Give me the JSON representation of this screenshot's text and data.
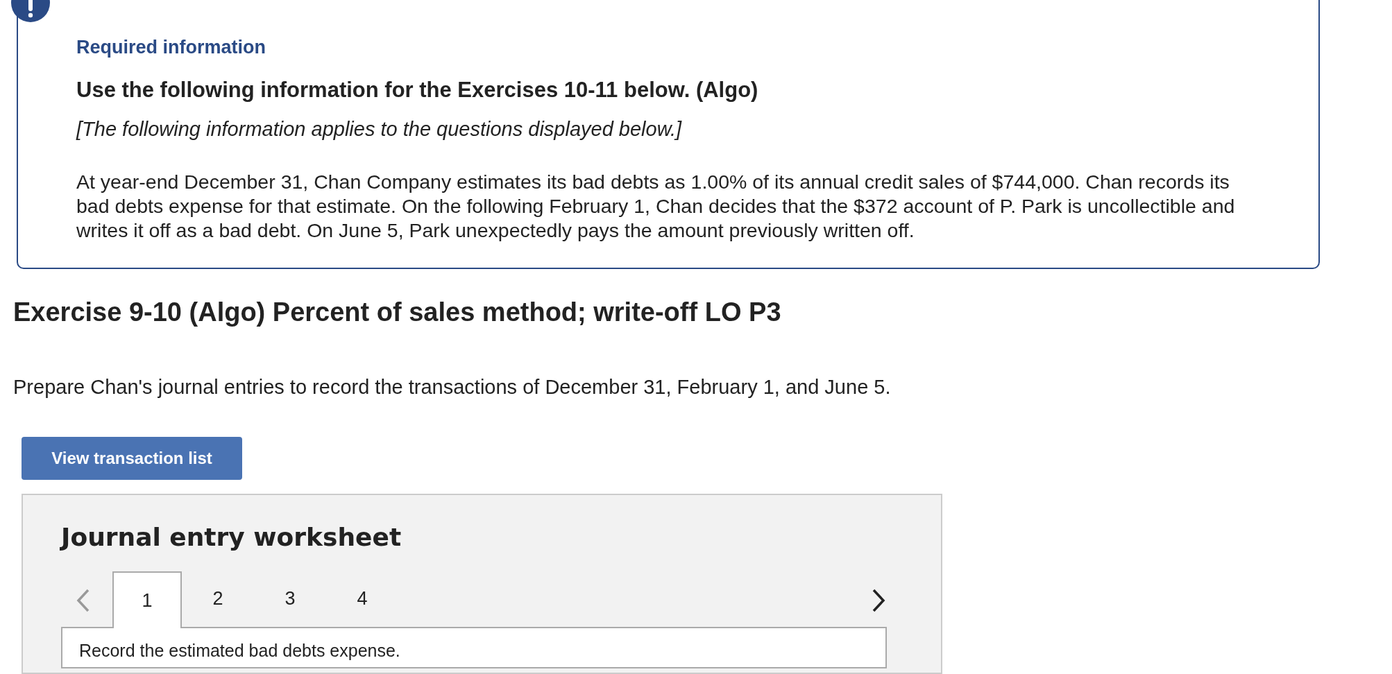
{
  "alert": {
    "label": "Required information",
    "heading": "Use the following information for the Exercises 10-11 below. (Algo)",
    "note": "[The following information applies to the questions displayed below.]",
    "paragraph": "At year-end December 31, Chan Company estimates its bad debts as 1.00% of its annual credit sales of $744,000. Chan records its bad debts expense for that estimate. On the following February 1, Chan decides that the $372 account of P. Park is uncollectible and writes it off as a bad debt. On June 5, Park unexpectedly pays the amount previously written off."
  },
  "exercise": {
    "title": "Exercise 9-10 (Algo) Percent of sales method; write-off LO P3",
    "instructions": "Prepare Chan's journal entries to record the transactions of December 31, February 1, and June 5."
  },
  "button": "View transaction list",
  "worksheet": {
    "title": "Journal entry worksheet",
    "prev_disabled": true,
    "next_disabled": false,
    "tabs": [
      {
        "label": "1",
        "selected": true
      },
      {
        "label": "2",
        "selected": false
      },
      {
        "label": "3",
        "selected": false
      },
      {
        "label": "4",
        "selected": false
      }
    ],
    "prompt": "Record the estimated bad debts expense."
  }
}
